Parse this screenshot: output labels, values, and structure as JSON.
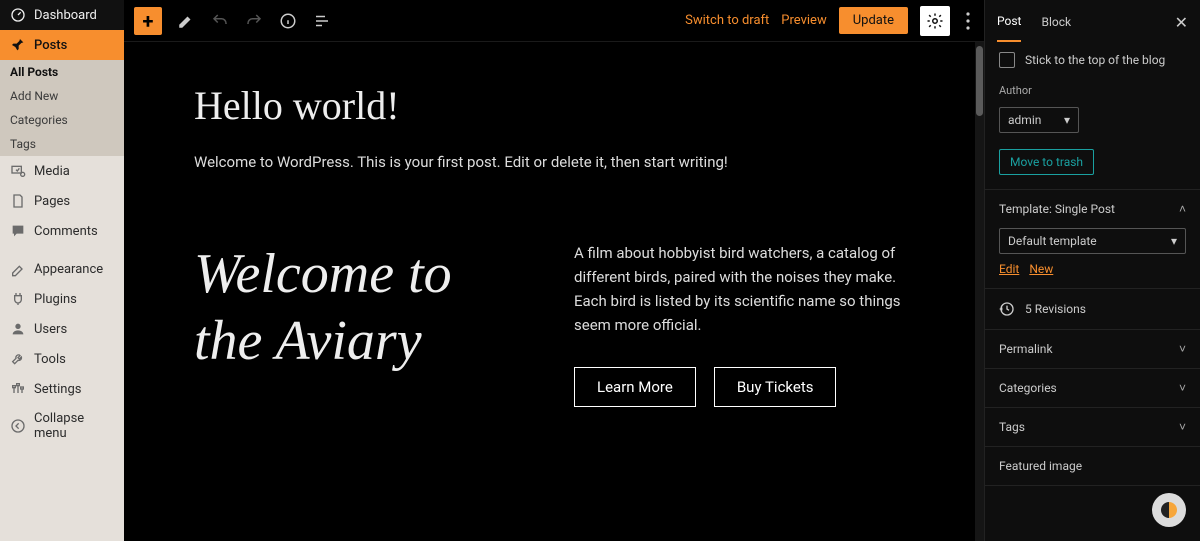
{
  "adminMenu": {
    "dashboard": "Dashboard",
    "posts": "Posts",
    "postsSub": {
      "all": "All Posts",
      "add": "Add New",
      "categories": "Categories",
      "tags": "Tags"
    },
    "media": "Media",
    "pages": "Pages",
    "comments": "Comments",
    "appearance": "Appearance",
    "plugins": "Plugins",
    "users": "Users",
    "tools": "Tools",
    "settings": "Settings",
    "collapse": "Collapse menu"
  },
  "toolbar": {
    "switchDraft": "Switch to draft",
    "preview": "Preview",
    "update": "Update"
  },
  "content": {
    "title": "Hello world!",
    "paragraph": "Welcome to WordPress. This is your first post. Edit or delete it, then start writing!",
    "heroTitle": "Welcome to the Aviary",
    "heroDesc": "A film about hobbyist bird watchers, a catalog of different birds, paired with the noises they make. Each bird is listed by its scientific name so things seem more official.",
    "btnLearn": "Learn More",
    "btnBuy": "Buy Tickets"
  },
  "panel": {
    "tabPost": "Post",
    "tabBlock": "Block",
    "stickLabel": "Stick to the top of the blog",
    "authorLabel": "Author",
    "authorValue": "admin",
    "moveTrash": "Move to trash",
    "templateTitle": "Template: Single Post",
    "templateValue": "Default template",
    "edit": "Edit",
    "new": "New",
    "revisions": "5 Revisions",
    "permalink": "Permalink",
    "categories": "Categories",
    "tags": "Tags",
    "featured": "Featured image"
  }
}
